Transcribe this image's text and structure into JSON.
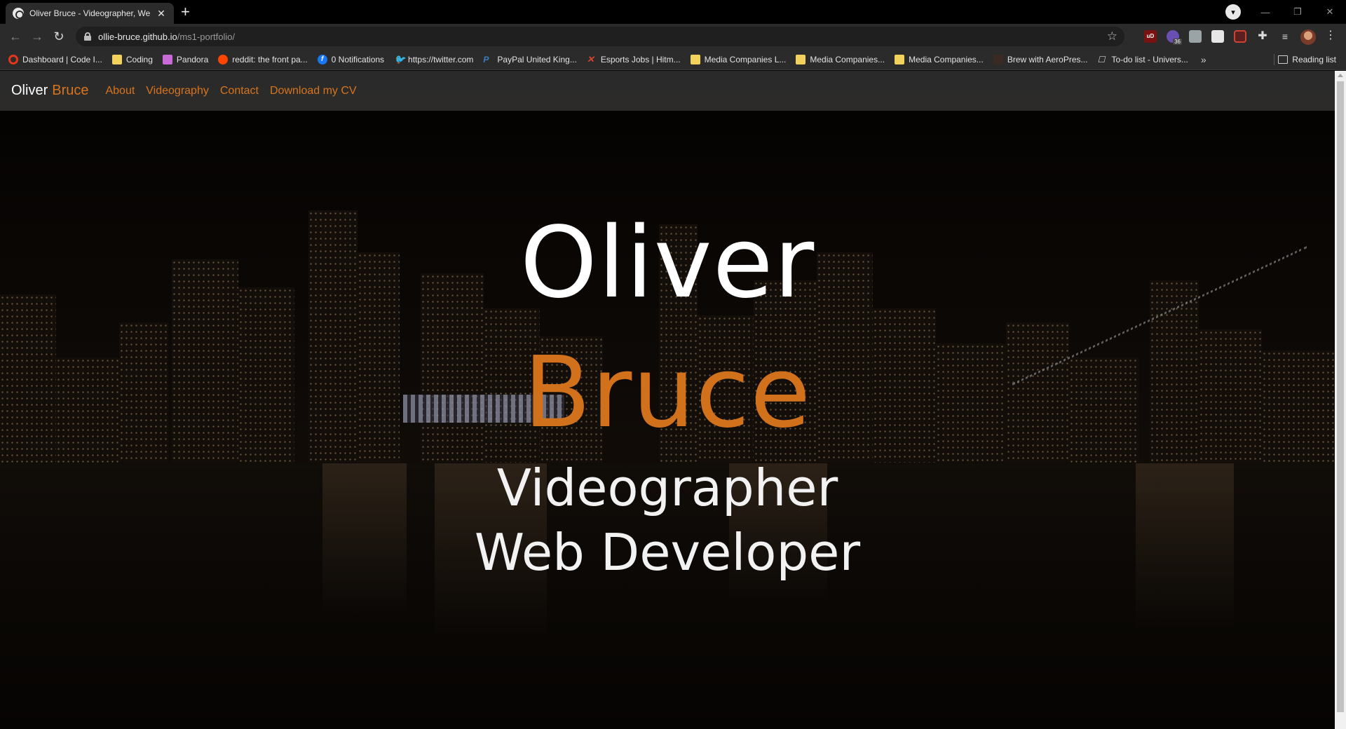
{
  "browser": {
    "tab_title": "Oliver Bruce - Videographer, Web",
    "url_host": "ollie-bruce.github.io",
    "url_path": "/ms1-portfolio/",
    "ublock_label": "uD",
    "ext_badge": "36",
    "bookmarks": [
      {
        "label": "Dashboard | Code I...",
        "icon": "code-institute-icon"
      },
      {
        "label": "Coding",
        "icon": "folder-icon"
      },
      {
        "label": "Pandora",
        "icon": "pandora-icon"
      },
      {
        "label": "reddit: the front pa...",
        "icon": "reddit-icon"
      },
      {
        "label": "0 Notifications",
        "icon": "facebook-icon"
      },
      {
        "label": "https://twitter.com",
        "icon": "twitter-icon"
      },
      {
        "label": "PayPal United King...",
        "icon": "paypal-icon"
      },
      {
        "label": "Esports Jobs | Hitm...",
        "icon": "hitmarker-icon"
      },
      {
        "label": "Media Companies L...",
        "icon": "folder-icon"
      },
      {
        "label": "Media Companies...",
        "icon": "folder-icon"
      },
      {
        "label": "Media Companies...",
        "icon": "folder-icon"
      },
      {
        "label": "Brew with AeroPres...",
        "icon": "aeropress-icon"
      },
      {
        "label": "To-do list - Univers...",
        "icon": "todo-icon"
      }
    ],
    "reading_list": "Reading list"
  },
  "site": {
    "brand_first": "Oliver",
    "brand_last": "Bruce",
    "nav": [
      "About",
      "Videography",
      "Contact",
      "Download my CV"
    ],
    "hero_first": "Oliver",
    "hero_last": "Bruce",
    "hero_role_1": "Videographer",
    "hero_role_2": "Web Developer"
  },
  "colors": {
    "accent": "#d2711c",
    "nav_bg": "#464646",
    "chrome_bg": "#2b2b2b"
  }
}
